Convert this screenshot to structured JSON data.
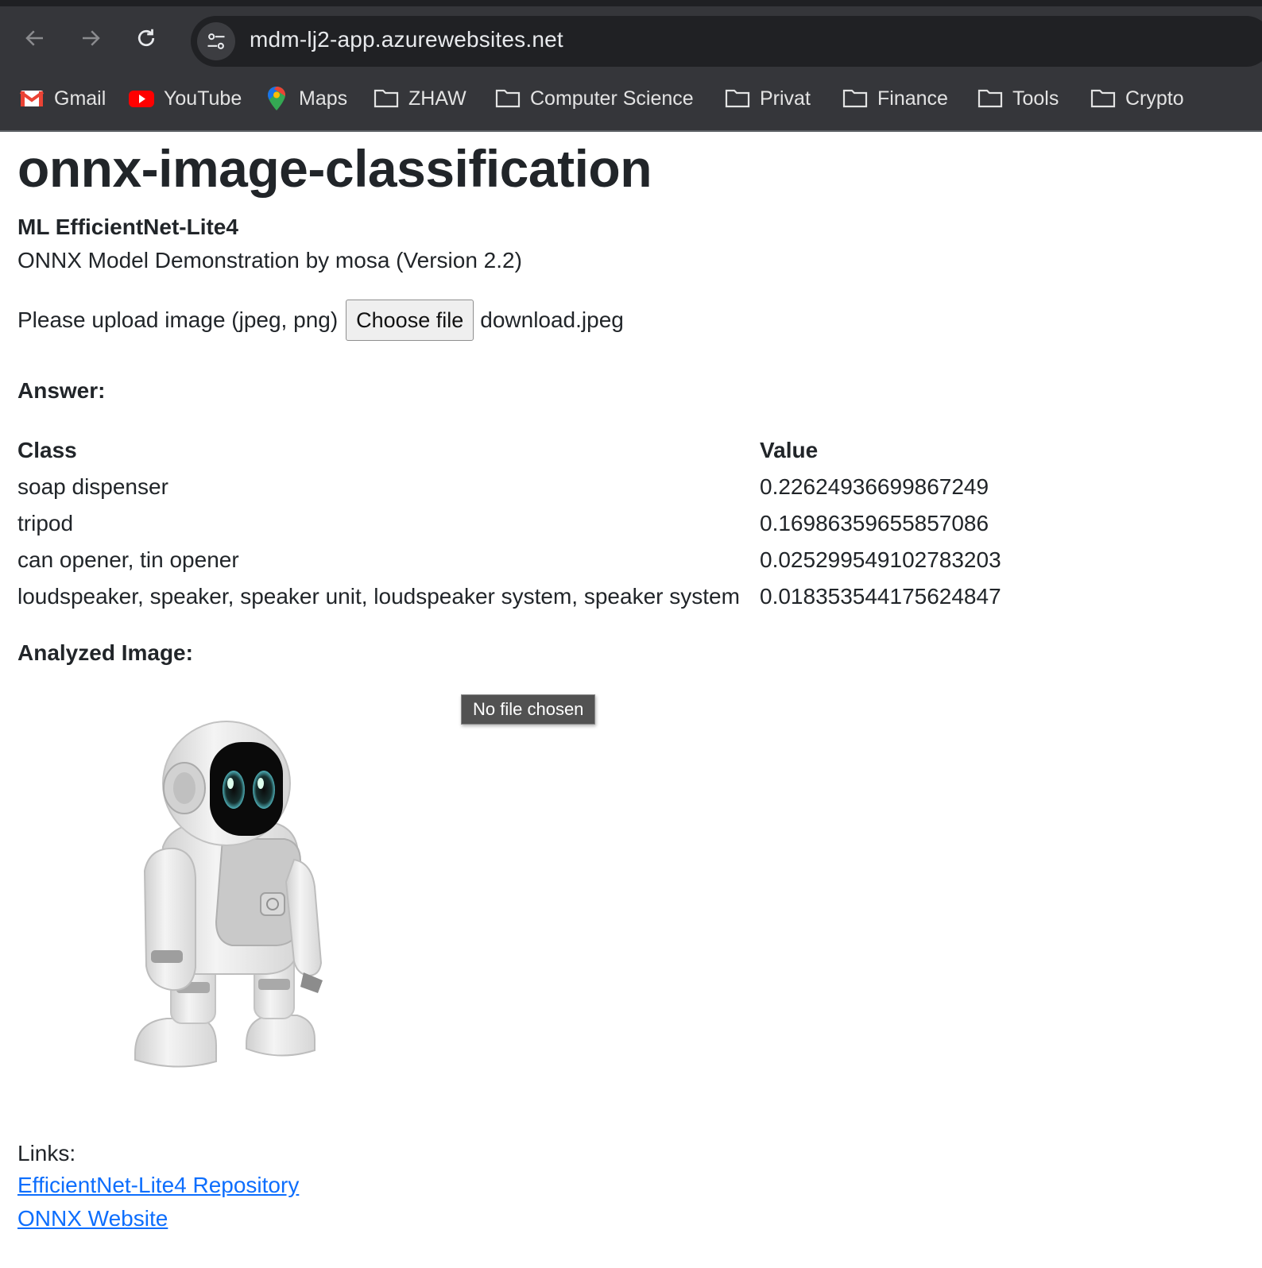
{
  "browser": {
    "url": "mdm-lj2-app.azurewebsites.net",
    "bookmarks": [
      {
        "label": "Gmail",
        "icon": "gmail-icon"
      },
      {
        "label": "YouTube",
        "icon": "youtube-icon"
      },
      {
        "label": "Maps",
        "icon": "maps-icon"
      },
      {
        "label": "ZHAW",
        "icon": "folder-icon"
      },
      {
        "label": "Computer Science",
        "icon": "folder-icon"
      },
      {
        "label": "Privat",
        "icon": "folder-icon"
      },
      {
        "label": "Finance",
        "icon": "folder-icon"
      },
      {
        "label": "Tools",
        "icon": "folder-icon"
      },
      {
        "label": "Crypto",
        "icon": "folder-icon"
      }
    ]
  },
  "page": {
    "title": "onnx-image-classification",
    "subtitle": "ML EfficientNet-Lite4",
    "description": "ONNX Model Demonstration by mosa (Version 2.2)",
    "upload_label": "Please upload image (jpeg, png)",
    "choose_file_label": "Choose file",
    "chosen_file": "download.jpeg",
    "answer_heading": "Answer:",
    "table": {
      "headers": [
        "Class",
        "Value"
      ],
      "rows": [
        [
          "soap dispenser",
          "0.22624936699867249"
        ],
        [
          "tripod",
          "0.16986359655857086"
        ],
        [
          "can opener, tin opener",
          "0.025299549102783203"
        ],
        [
          "loudspeaker, speaker, speaker unit, loudspeaker system, speaker system",
          "0.018353544175624847"
        ]
      ]
    },
    "analyzed_heading": "Analyzed Image:",
    "tooltip": "No file chosen",
    "links_label": "Links:",
    "links": [
      {
        "label": "EfficientNet-Lite4 Repository"
      },
      {
        "label": "ONNX Website"
      }
    ]
  },
  "colors": {
    "chrome_bg": "#35363a",
    "omnibox_bg": "#202124",
    "link": "#0d6efd",
    "text": "#212529"
  }
}
